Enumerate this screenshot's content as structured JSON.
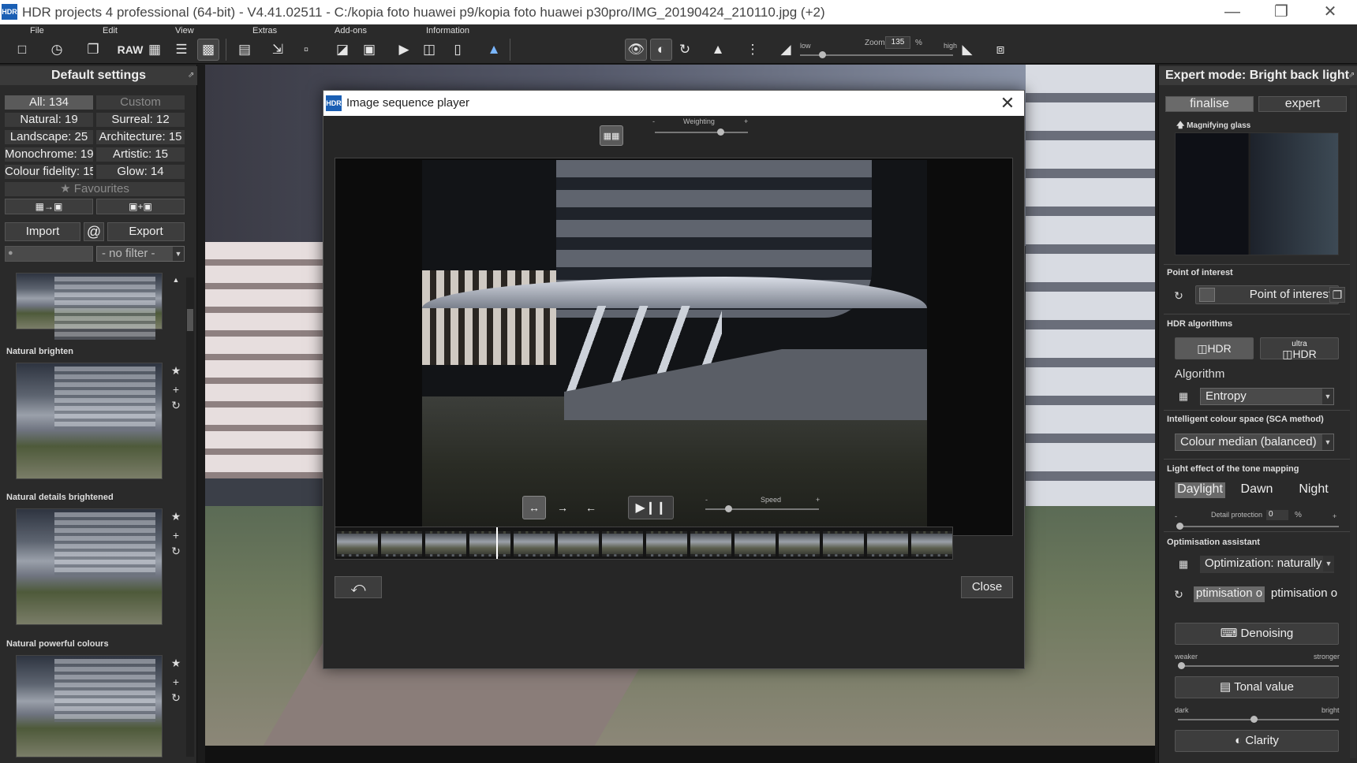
{
  "window": {
    "logo": "HDR",
    "title": "HDR projects 4 professional (64-bit) - V4.41.02511 - C:/kopia foto huawei p9/kopia foto huawei p30pro/IMG_20190424_210110.jpg (+2)"
  },
  "menu": {
    "file": "File",
    "edit": "Edit",
    "view": "View",
    "extras": "Extras",
    "addons": "Add-ons",
    "information": "Information"
  },
  "toolbar": {
    "raw_label": "RAW",
    "zoom_low": "low",
    "zoom_label": "Zoom",
    "zoom_value": "135",
    "zoom_unit": "%",
    "zoom_high": "high"
  },
  "left_panel": {
    "header": "Default settings",
    "categories": [
      "All: 134",
      "Custom",
      "Natural: 19",
      "Surreal: 12",
      "Landscape: 25",
      "Architecture: 15",
      "Monochrome: 19",
      "Artistic: 15",
      "Colour fidelity: 15",
      "Glow: 14"
    ],
    "favourites": "★ Favourites",
    "import": "Import",
    "at": "@",
    "export": "Export",
    "filter": "- no filter -",
    "presets": [
      "Natural brighten",
      "Natural details brightened",
      "Natural powerful colours"
    ]
  },
  "dialog": {
    "logo": "HDR",
    "title": "Image sequence player",
    "weighting_label": "Weighting",
    "weighting_minus": "-",
    "weighting_plus": "+",
    "weighting_value": 0.7,
    "speed_label": "Speed",
    "speed_minus": "-",
    "speed_plus": "+",
    "speed_value": 0.2,
    "play_pause": "▶❙❙",
    "close": "Close",
    "filmstrip_frames": 14,
    "playhead_position": 0.26
  },
  "right_panel": {
    "header": "Expert mode: Bright back light",
    "tab_finalise": "finalise",
    "tab_expert": "expert",
    "magnifying_glass": "Magnifying glass",
    "point_of_interest_heading": "Point of interest",
    "point_of_interest_button": "Point of interest",
    "hdr_algorithms_heading": "HDR algorithms",
    "hdr_button": "HDR",
    "ultra_hdr_top": "ultra",
    "ultra_hdr_bottom": "HDR",
    "algorithm_label": "Algorithm",
    "algorithm_value": "Entropy",
    "colour_space_heading": "Intelligent colour space (SCA method)",
    "colour_space_value": "Colour median (balanced)",
    "light_effect_heading": "Light effect of the tone mapping",
    "light_daylight": "Daylight",
    "light_dawn": "Dawn",
    "light_night": "Night",
    "detail_minus": "-",
    "detail_protection_label": "Detail protection",
    "detail_protection_value": "0",
    "detail_unit": "%",
    "detail_plus": "+",
    "optimisation_heading": "Optimisation assistant",
    "optimization_value": "Optimization: naturally",
    "optimisation_sel": "ptimisation o",
    "optimisation_other": "ptimisation o",
    "denoising": "Denoising",
    "weaker": "weaker",
    "stronger": "stronger",
    "denoising_level": 0.02,
    "tonal_value": "Tonal value",
    "dark": "dark",
    "bright": "bright",
    "tonal_level": 0.47,
    "clarity": "Clarity"
  }
}
